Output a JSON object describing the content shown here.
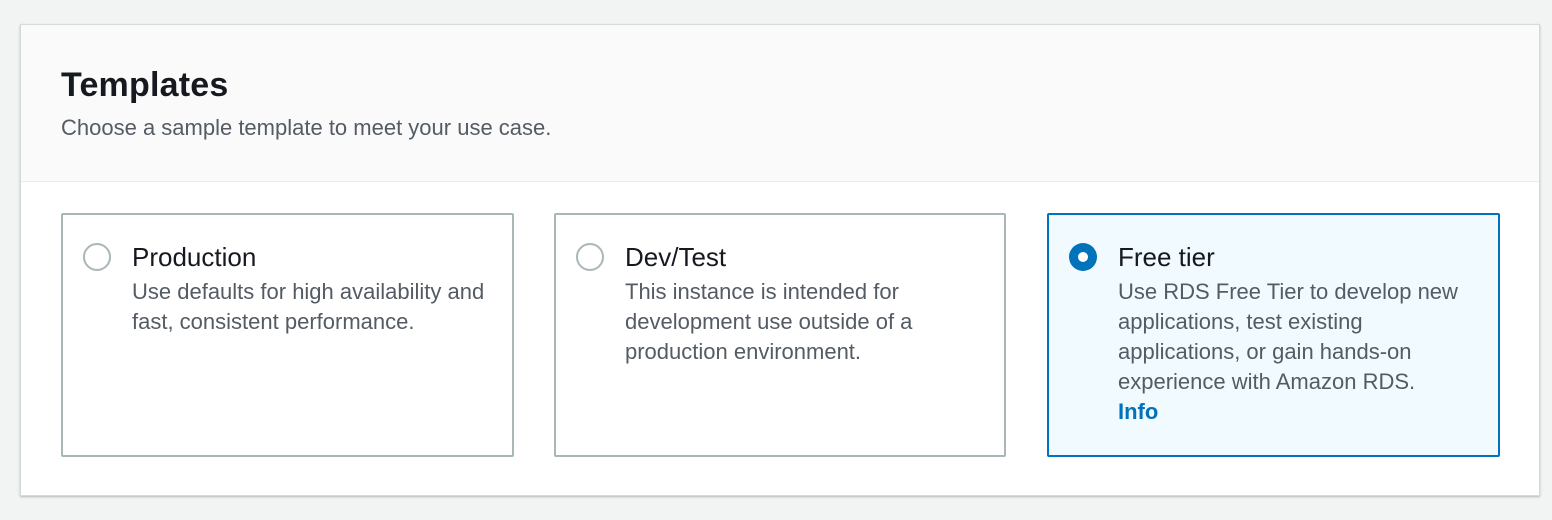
{
  "section": {
    "title": "Templates",
    "description": "Choose a sample template to meet your use case."
  },
  "options": [
    {
      "label": "Production",
      "description": "Use defaults for high availability and fast, consistent performance.",
      "selected": false
    },
    {
      "label": "Dev/Test",
      "description": "This instance is intended for development use outside of a production environment.",
      "selected": false
    },
    {
      "label": "Free tier",
      "description": "Use RDS Free Tier to develop new applications, test existing applications, or gain hands-on experience with Amazon RDS.",
      "selected": true,
      "link": "Info"
    }
  ],
  "colors": {
    "accent": "#0073bb",
    "selected_background": "#f1faff",
    "border": "#aab7b8",
    "header_background": "#fafafa"
  }
}
